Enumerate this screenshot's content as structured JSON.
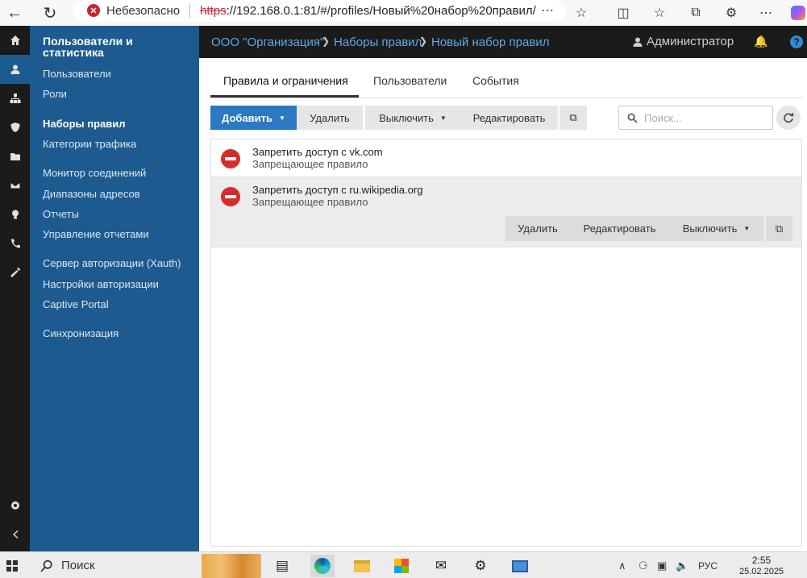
{
  "browser": {
    "insecure_label": "Небезопасно",
    "url_scheme": "https",
    "url_rest": "://192.168.0.1:81/#/profiles/Новый%20набор%20правил/"
  },
  "header": {
    "breadcrumb": [
      "ООО \"Организация\"",
      "Наборы правил",
      "Новый набор правил"
    ],
    "user": "Администратор"
  },
  "sidebar": {
    "heading": "Пользователи и статистика",
    "items": [
      {
        "label": "Пользователи"
      },
      {
        "label": "Роли"
      },
      {
        "label": "Наборы правил",
        "active": true
      },
      {
        "label": "Категории трафика"
      },
      {
        "label": "Монитор соединений"
      },
      {
        "label": "Диапазоны адресов"
      },
      {
        "label": "Отчеты"
      },
      {
        "label": "Управление отчетами"
      },
      {
        "label": "Сервер авторизации (Xauth)"
      },
      {
        "label": "Настройки авторизации"
      },
      {
        "label": "Captive Portal"
      },
      {
        "label": "Синхронизация"
      }
    ]
  },
  "tabs": [
    {
      "label": "Правила и ограничения",
      "active": true
    },
    {
      "label": "Пользователи"
    },
    {
      "label": "События"
    }
  ],
  "toolbar": {
    "add": "Добавить",
    "delete": "Удалить",
    "disable": "Выключить",
    "edit": "Редактировать",
    "search_placeholder": "Поиск..."
  },
  "rules": [
    {
      "title": "Запретить доступ с vk.com",
      "type": "Запрещающее правило"
    },
    {
      "title": "Запретить доступ с ru.wikipedia.org",
      "type": "Запрещающее правило",
      "selected": true
    }
  ],
  "row_actions": {
    "delete": "Удалить",
    "edit": "Редактировать",
    "disable": "Выключить"
  },
  "taskbar": {
    "search": "Поиск",
    "language": "РУС",
    "time": "2:55",
    "date": "25.02.2025"
  },
  "colors": {
    "sidebar": "#1d5a8f",
    "primary": "#2b79c2",
    "link": "#5fa8e8",
    "deny": "#d62c2c"
  }
}
